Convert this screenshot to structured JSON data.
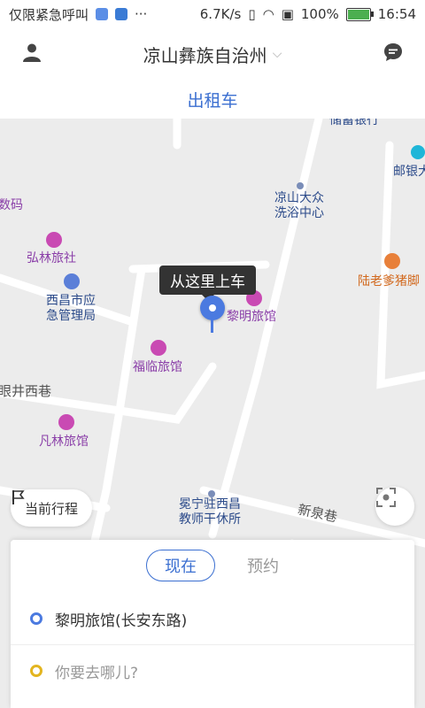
{
  "statusbar": {
    "left_text": "仅限紧急呼叫",
    "speed": "6.7K/s",
    "battery": "100%",
    "time": "16:54",
    "battery_level": 1.0
  },
  "header": {
    "title": "凉山彝族自治州",
    "dropdown_glyph": "⌵"
  },
  "tab": {
    "label": "出租车"
  },
  "map": {
    "pois": [
      {
        "text": "储蓄银行"
      },
      {
        "text": "邮银大"
      },
      {
        "text": "数码"
      },
      {
        "text": "凉山大众\n洗浴中心"
      },
      {
        "text": "弘林旅社"
      },
      {
        "text": "陆老爹猪脚"
      },
      {
        "text": "西昌市应\n急管理局"
      },
      {
        "text": "黎明旅馆"
      },
      {
        "text": "福临旅馆"
      },
      {
        "text": "眼井西巷"
      },
      {
        "text": "凡林旅馆"
      },
      {
        "text": "冕宁驻西昌\n教师干休所"
      },
      {
        "text": "新泉巷"
      }
    ],
    "callout": "从这里上车",
    "trip_pill": "当前行程"
  },
  "panel": {
    "mode_now": "现在",
    "mode_reserve": "预约",
    "start_location": "黎明旅馆(长安东路)",
    "destination_placeholder": "你要去哪儿?"
  },
  "colors": {
    "accent": "#3b6fd1",
    "poi_purple": "#8a3ea8",
    "poi_orange": "#d2691e"
  }
}
